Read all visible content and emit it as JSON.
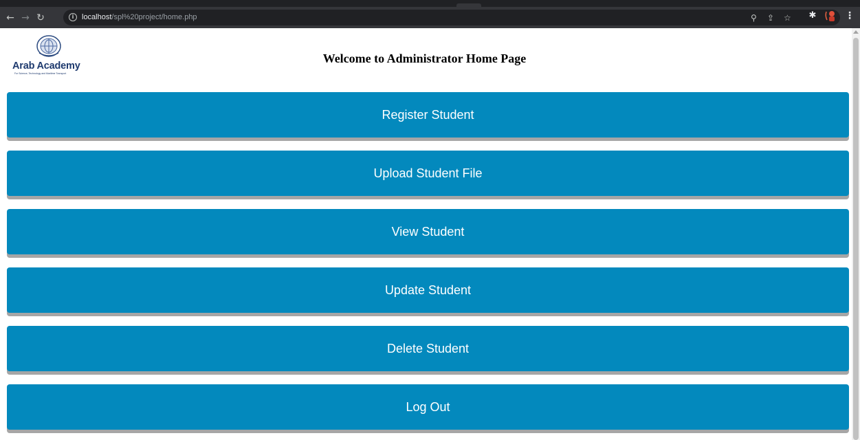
{
  "browser": {
    "url_host": "localhost",
    "url_path": "/spl%20project/home.php"
  },
  "logo": {
    "name": "Arab Academy",
    "tagline": "For Science, Technology and Maritime Transport"
  },
  "header": {
    "title": "Welcome to Administrator Home Page"
  },
  "menu": [
    {
      "label": "Register Student"
    },
    {
      "label": "Upload Student File"
    },
    {
      "label": "View Student"
    },
    {
      "label": "Update Student"
    },
    {
      "label": "Delete Student"
    },
    {
      "label": "Log Out"
    }
  ],
  "colors": {
    "button": "#0389bd",
    "button_shadow": "#a6a6a6",
    "logo_text": "#1e3a6e"
  },
  "icons": [
    "back-arrow-icon",
    "forward-arrow-icon",
    "reload-icon",
    "info-icon",
    "zoom-icon",
    "share-icon",
    "bookmark-star-icon",
    "extensions-puzzle-icon",
    "profile-avatar-icon",
    "menu-kebab-icon"
  ]
}
